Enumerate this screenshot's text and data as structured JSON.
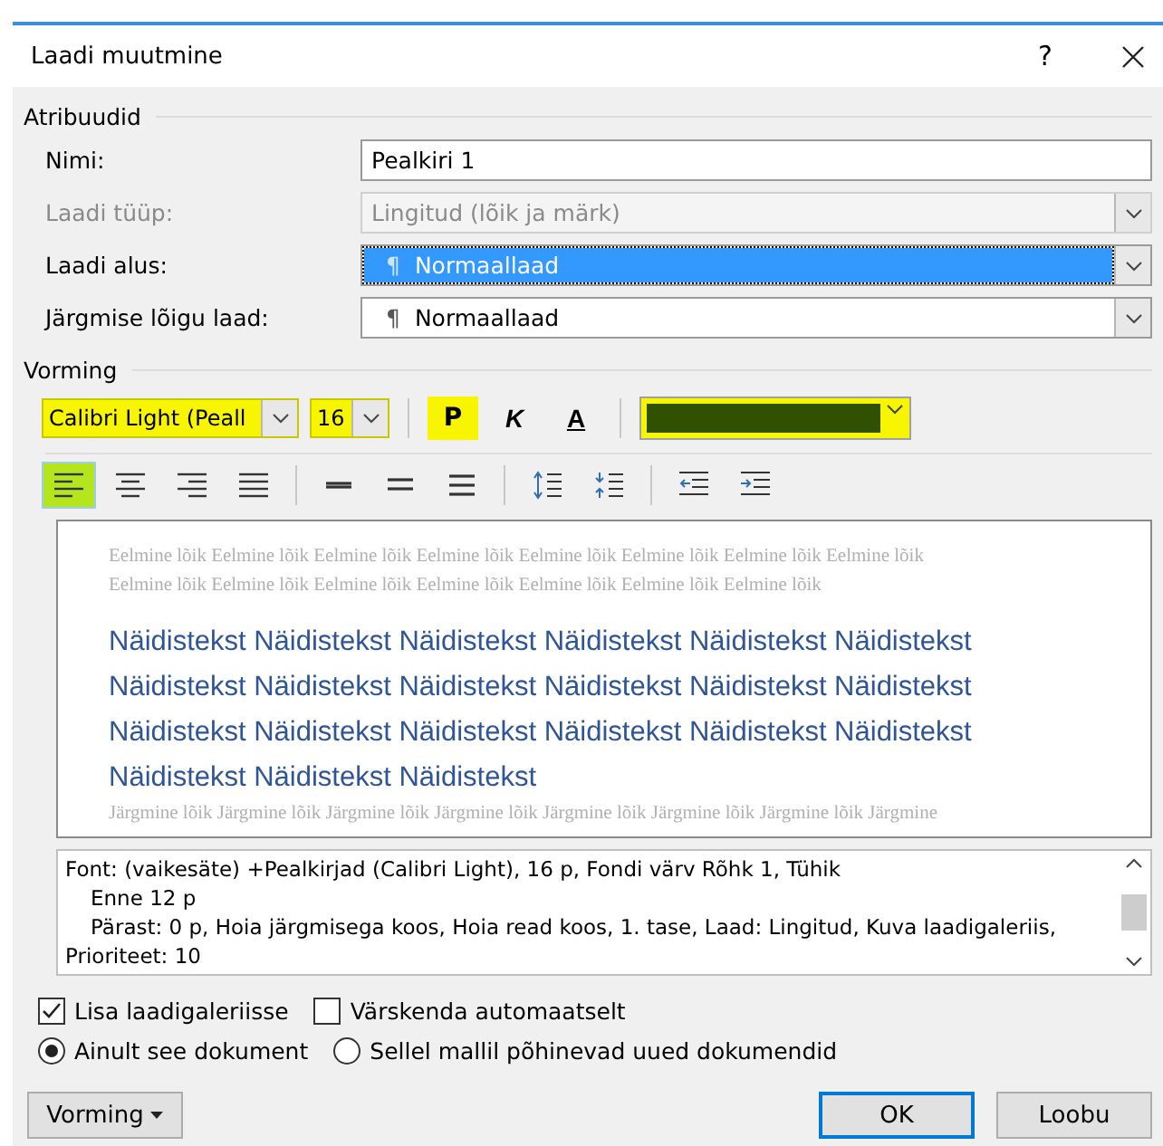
{
  "window": {
    "title": "Laadi muutmine",
    "help": "?"
  },
  "attributes": {
    "title": "Atribuudid",
    "fields": [
      {
        "label": "Nimi:",
        "kind": "text",
        "value": "Pealkiri 1",
        "disabled": false,
        "selected": false
      },
      {
        "label": "Laadi tüüp:",
        "kind": "dropdown",
        "value": "Lingitud (lõik ja märk)",
        "disabled": true,
        "selected": false
      },
      {
        "label": "Laadi alus:",
        "kind": "dropdown",
        "value": "Normaallaad",
        "pilcrow": "¶",
        "disabled": false,
        "selected": true
      },
      {
        "label": "Järgmise lõigu laad:",
        "kind": "dropdown",
        "value": "Normaallaad",
        "pilcrow": "¶",
        "disabled": false,
        "selected": false
      }
    ]
  },
  "formatting": {
    "title": "Vorming",
    "font": {
      "value": "Calibri Light (Peall",
      "highlighted": true
    },
    "size": {
      "value": "16",
      "highlighted": true
    },
    "styles": [
      {
        "label": "P",
        "kind": "bold",
        "highlighted": true
      },
      {
        "label": "K",
        "kind": "italic",
        "highlighted": false
      },
      {
        "label": "A",
        "kind": "underline",
        "highlighted": false
      }
    ],
    "color": {
      "color": "#2f5100",
      "highlighted": true
    },
    "paragraph_buttons": [
      {
        "kind": "align-left",
        "selected": true
      },
      {
        "kind": "align-center",
        "selected": false
      },
      {
        "kind": "align-right",
        "selected": false
      },
      {
        "kind": "justify",
        "selected": false
      },
      {
        "kind": "single-spacing",
        "selected": false
      },
      {
        "kind": "onehalf-spacing",
        "selected": false
      },
      {
        "kind": "double-spacing",
        "selected": false
      },
      {
        "kind": "increase-spacing",
        "selected": false
      },
      {
        "kind": "decrease-spacing",
        "selected": false
      },
      {
        "kind": "outdent",
        "selected": false
      },
      {
        "kind": "indent",
        "selected": false
      }
    ]
  },
  "preview": {
    "previous": [
      "Eelmine lõik Eelmine lõik Eelmine lõik Eelmine lõik Eelmine lõik Eelmine lõik Eelmine lõik Eelmine lõik",
      "Eelmine lõik Eelmine lõik Eelmine lõik Eelmine lõik Eelmine lõik Eelmine lõik Eelmine lõik"
    ],
    "sample": [
      "Näidistekst Näidistekst Näidistekst Näidistekst Näidistekst Näidistekst",
      "Näidistekst Näidistekst Näidistekst Näidistekst Näidistekst Näidistekst",
      "Näidistekst Näidistekst Näidistekst Näidistekst Näidistekst Näidistekst",
      "Näidistekst Näidistekst Näidistekst"
    ],
    "next": [
      "Järgmine lõik Järgmine lõik Järgmine lõik Järgmine lõik Järgmine lõik Järgmine lõik Järgmine lõik Järgmine"
    ]
  },
  "description": [
    {
      "text": "Font: (vaikesäte) +Pealkirjad (Calibri Light), 16 p, Fondi värv Rõhk 1, Tühik",
      "indented": false
    },
    {
      "text": "Enne  12 p",
      "indented": true
    },
    {
      "text": "Pärast:  0 p, Hoia järgmisega koos, Hoia read koos, 1. tase, Laad: Lingitud, Kuva laadigaleriis,",
      "indented": true
    },
    {
      "text": "Prioriteet: 10",
      "indented": false
    }
  ],
  "checkboxes": [
    {
      "label": "Lisa laadigaleriisse",
      "checked": true
    },
    {
      "label": "Värskenda automaatselt",
      "checked": false
    }
  ],
  "radios": [
    {
      "label": "Ainult see dokument",
      "selected": true
    },
    {
      "label": "Sellel mallil põhinevad uued dokumendid",
      "selected": false
    }
  ],
  "footer": {
    "menu_button": "Vorming",
    "buttons": [
      {
        "label": "OK",
        "kind": "default"
      },
      {
        "label": "Loobu",
        "kind": "normal"
      }
    ]
  }
}
